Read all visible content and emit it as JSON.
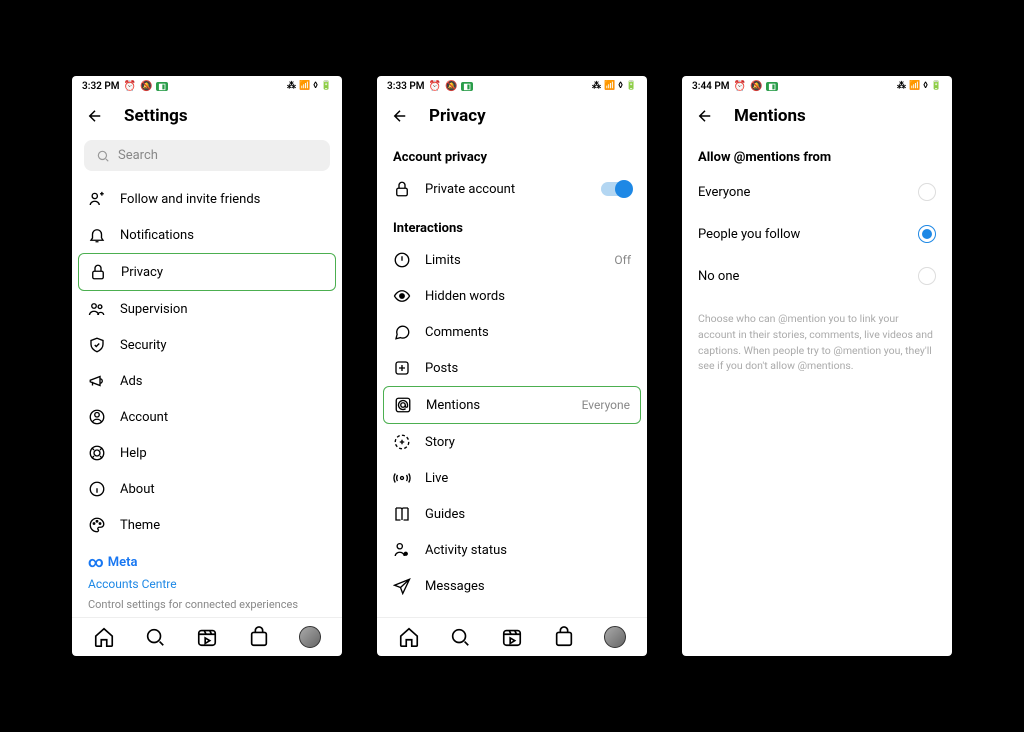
{
  "screen1": {
    "time": "3:32 PM",
    "title": "Settings",
    "search_placeholder": "Search",
    "items": [
      {
        "label": "Follow and invite friends"
      },
      {
        "label": "Notifications"
      },
      {
        "label": "Privacy",
        "highlighted": true
      },
      {
        "label": "Supervision"
      },
      {
        "label": "Security"
      },
      {
        "label": "Ads"
      },
      {
        "label": "Account"
      },
      {
        "label": "Help"
      },
      {
        "label": "About"
      },
      {
        "label": "Theme"
      }
    ],
    "meta": {
      "brand": "Meta",
      "accounts_link": "Accounts Centre",
      "description": "Control settings for connected experiences across"
    }
  },
  "screen2": {
    "time": "3:33 PM",
    "title": "Privacy",
    "section1": "Account privacy",
    "private_label": "Private account",
    "section2": "Interactions",
    "items": [
      {
        "label": "Limits",
        "trail": "Off"
      },
      {
        "label": "Hidden words"
      },
      {
        "label": "Comments"
      },
      {
        "label": "Posts"
      },
      {
        "label": "Mentions",
        "trail": "Everyone",
        "highlighted": true
      },
      {
        "label": "Story"
      },
      {
        "label": "Live"
      },
      {
        "label": "Guides"
      },
      {
        "label": "Activity status"
      },
      {
        "label": "Messages"
      }
    ]
  },
  "screen3": {
    "time": "3:44 PM",
    "title": "Mentions",
    "section": "Allow @mentions from",
    "options": [
      {
        "label": "Everyone",
        "selected": false
      },
      {
        "label": "People you follow",
        "selected": true
      },
      {
        "label": "No one",
        "selected": false
      }
    ],
    "help": "Choose who can @mention you to link your account in their stories, comments, live videos and captions. When people try to @mention you, they'll see if you don't allow @mentions."
  }
}
